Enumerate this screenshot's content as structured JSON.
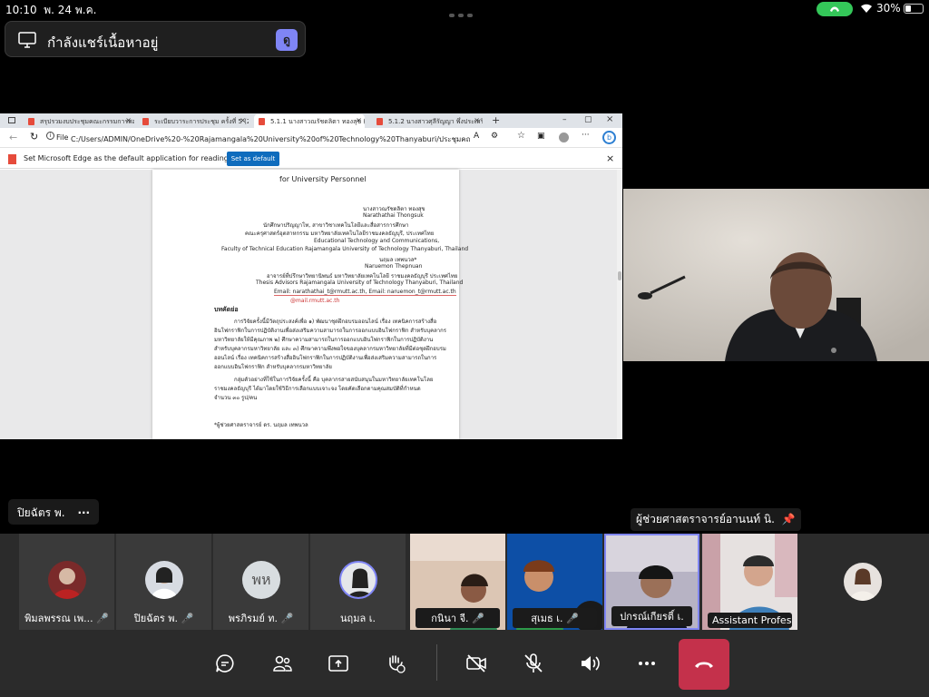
{
  "status_bar": {
    "time": "10:10",
    "date": "พ. 24 พ.ค.",
    "battery": "30%"
  },
  "share_banner": {
    "label": "กำลังแชร์เนื้อหาอยู่",
    "view_badge": "ดู"
  },
  "browser": {
    "tabs": [
      {
        "title": "สรุปรวมงบประชุมคณะกรรมการสอบ",
        "active": false
      },
      {
        "title": "ระเบียบวาระการประชุม ครั้งที่ 5 (24-พ",
        "active": false
      },
      {
        "title": "5.1.1 นางสาวณรัชดลิตา ทองสุข (ปริญ",
        "active": true
      },
      {
        "title": "5.1.2 นางสาวศุลีรัญญา พึ่งประเสริฐ (ปริญ",
        "active": false
      }
    ],
    "file_label": "File",
    "url": "C:/Users/ADMIN/OneDrive%20-%20Rajamangala%20University%20of%20Technology%20Thanyaburi/ประชุมคณะกรรมการบัณฑิตศึกษา/...",
    "notice": "Set Microsoft Edge as the default application for reading PDF files?",
    "notice_button": "Set as default"
  },
  "pdf": {
    "heading": "for University Personnel",
    "author_th": "นางสาวณรัชดลิตา ทองสุข",
    "author_en": "Narathathai Thongsuk",
    "line1": "นักศึกษาปริญญาโท, สาขาวิชาเทคโนโลยีและสื่อสารการศึกษา",
    "line2": "คณะครุศาสตร์อุตสาหกรรม มหาวิทยาลัยเทคโนโลยีราชมงคลธัญบุรี, ประเทศไทย",
    "line3": "Educational Technology and Communications,",
    "line4": "Faculty of Technical Education Rajamangala University of Technology Thanyaburi, Thailand",
    "line5": "นฤมล เทพนวล*",
    "line6": "Naruemon Thepnuan",
    "line7": "อาจารย์ที่ปรึกษาวิทยานิพนธ์ มหาวิทยาลัยเทคโนโลยี ราชมงคลธัญบุรี ประเทศไทย",
    "line8": "Thesis Advisors Rajamangala University of Technology Thanyaburi, Thailand",
    "line9": "Email: narathathai_t@rmutt.ac.th, Email: naruemon_t@rmutt.ac.th",
    "line10": "@mail.rmutt.ac.th",
    "abstract_title": "บทคัดย่อ",
    "p1": "การวิจัยครั้งนี้มีวัตถุประสงค์เพื่อ ๑) พัฒนาชุดฝึกอบรมออนไลน์ เรื่อง เทคนิคการสร้างสื่อ",
    "p2": "อินโฟกราฟิกในการปฏิบัติงานเพื่อส่งเสริมความสามารถในการออกแบบอินโฟกราฟิก สำหรับบุคลากร",
    "p3": "มหาวิทยาลัยให้มีคุณภาพ ๒) ศึกษาความสามารถในการออกแบบอินโฟกราฟิกในการปฏิบัติงาน",
    "p4": "สำหรับบุคลากรมหาวิทยาลัย และ ๓) ศึกษาความพึงพอใจของบุคลากรมหาวิทยาลัยที่มีต่อชุดฝึกอบรม",
    "p5": "ออนไลน์ เรื่อง เทคนิคการสร้างสื่ออินโฟกราฟิกในการปฏิบัติงานเพื่อส่งเสริมความสามารถในการ",
    "p6": "ออกแบบอินโฟกราฟิก สำหรับบุคลากรมหาวิทยาลัย",
    "p7": "กลุ่มตัวอย่างที่ใช้ในการวิจัยครั้งนี้ คือ บุคลากรสายสนับสนุนในมหาวิทยาลัยเทคโนโลย",
    "p8": "ราชมงคลธัญบุรี ได้มาโดยใช้วิธีการเลือกแบบเจาะจง โดยคัดเลือกตามคุณสมบัติที่กำหนด",
    "p9": "จำนวน ๓๐ รูป/คน",
    "footnote": "*ผู้ช่วยศาสตราจารย์ ดร. นฤมล เทพนวล"
  },
  "presenter_label": "ปิยฉัตร พ.",
  "remote_label": "ผู้ช่วยศาสตราจารย์อานนท์ นิ.",
  "participants": [
    {
      "name": "พิมลพรรณ เพ...",
      "type": "avatar",
      "initials": ""
    },
    {
      "name": "ปิยฉัตร พ.",
      "type": "avatar",
      "initials": ""
    },
    {
      "name": "พรภิรมย์ ท.",
      "type": "avatar",
      "initials": "พห"
    },
    {
      "name": "นฤมล เ.",
      "type": "avatar",
      "initials": ""
    },
    {
      "name": "กนินา จี.",
      "type": "video"
    },
    {
      "name": "สุเมธ เ.",
      "type": "video"
    },
    {
      "name": "ปกรณ์เกียรติ์ เ.",
      "type": "video"
    },
    {
      "name": "Assistant Profes...",
      "type": "video"
    }
  ],
  "colors": {
    "teams_purple": "#7f85f5",
    "hangup_red": "#c4314b",
    "call_green": "#34c759",
    "edge_blue": "#0f6cbd"
  }
}
